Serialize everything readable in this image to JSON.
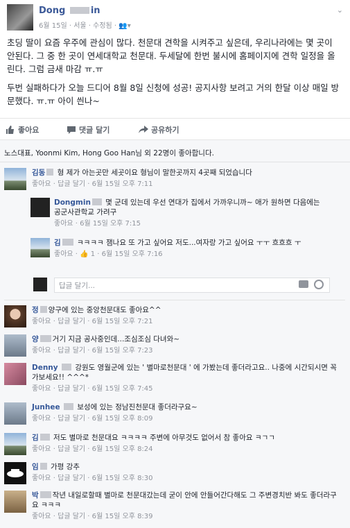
{
  "post": {
    "author": "Dong",
    "author_tail": "in",
    "meta": "6월 15일 · 서울 · 수정됨 · 👥▾",
    "paragraph1": "초딩 딸이 요즘 우주에 관심이 많다. 천문대 견학을 시켜주고 싶은데, 우리나라에는 몇 곳이 안된다. 그 중 한 곳이 연세대학교 천문대. 두세달에 한번 불시에 홈페이지에 견학 일정을 올린다. 그럼 금새 마감 ㅠ.ㅠ",
    "paragraph2": "두번 실패하다가 오늘 드디어 8월 8일 신청에 성공! 공지사항 보려고 거의 한달 이상 매일 방문했다. ㅠ.ㅠ 아이 씐나~"
  },
  "actions": {
    "like": "좋아요",
    "comment": "댓글 달기",
    "share": "공유하기"
  },
  "likes_summary": "노스대표, Yoonmi Kim, Hong Goo Han님 외 22명이 좋아합니다.",
  "comments": [
    {
      "name": "김동",
      "text": "형 제가 아는곳만 세곳이요 형님이 말한곳까지 4곳째 되었습니다",
      "meta": "좋아요 · 답글 달기 · 6월 15일 오후 7:11"
    },
    {
      "name": "Dongmin",
      "text": "몇 군데 있는데 우선 연대가 집에서 가까우니까~ 애가 원하면 다음에는 공군사관학교 가려구",
      "meta": "좋아요 · 6월 15일 오후 7:15"
    },
    {
      "name": "김",
      "text": "ㅋㅋㅋㅋ 잼나요 또 가고 싶어요 저도...여자랑 가고 싶어요 ㅜㅜ 흐흐흐 ㅜ",
      "meta": "좋아요 · 👍 1 · 6월 15일 오후 7:16"
    },
    {
      "name": "정",
      "text": "양구에 있는 중앙천문대도 좋아요^^",
      "meta": "좋아요 · 답글 달기 · 6월 15일 오후 7:21"
    },
    {
      "name": "양",
      "text": "거기 지금 공사중인데...조심조심 다녀와~",
      "meta": "좋아요 · 답글 달기 · 6월 15일 오후 7:23"
    },
    {
      "name": "Denny",
      "text": "강원도 영월군에 있는 ' 별마로천문대 ' 에 가봤는데 좋더라고요.. 나중에 시간되시면 꼭 가보세요!! ^^^*",
      "meta": "좋아요 · 답글 달기 · 6월 15일 오후 7:45"
    },
    {
      "name": "Junhee",
      "text": "보성에 있는 정남진천문대 좋더라구요~",
      "meta": "좋아요 · 답글 달기 · 6월 15일 오후 8:09"
    },
    {
      "name": "김",
      "text": "저도 별마로 천문대요 ㅋㅋㅋㅋ 주변에 아무것도 없어서 참 좋아요 ㅋㄱㄱ",
      "meta": "좋아요 · 답글 달기 · 6월 15일 오후 8:24"
    },
    {
      "name": "임",
      "text": "가평 강추",
      "meta": "좋아요 · 답글 달기 · 6월 15일 오후 8:30"
    },
    {
      "name": "박",
      "text": "작년 내일로할때 별마로 천문대갔는데 굳이 안에 안들어간다해도 그 주변경치반 봐도 좋더라구요 ㅋㅋㅋ",
      "meta": "좋아요 · 답글 달기 · 6월 15일 오후 8:39"
    }
  ],
  "reply_placeholder": "답글 달기...",
  "icons": {
    "like": "thumbs-up-icon",
    "comment": "comment-icon",
    "share": "share-icon",
    "audience": "friends-icon",
    "chevron": "chevron-down-icon",
    "camera": "camera-icon",
    "emoji": "emoji-icon"
  }
}
